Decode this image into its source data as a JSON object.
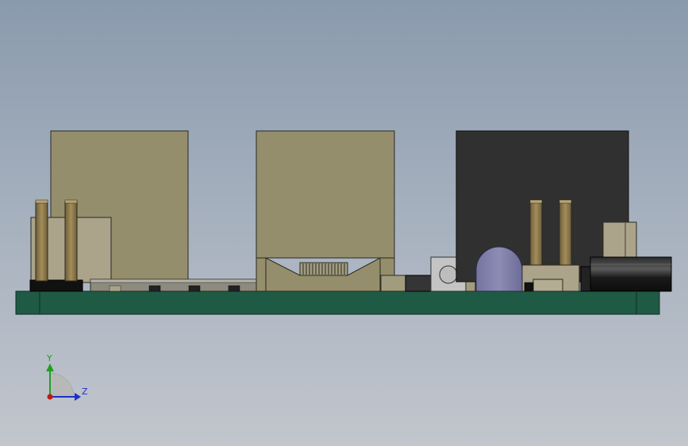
{
  "viewport": {
    "background_top": "#8a9aad",
    "background_bottom": "#c2c6cd"
  },
  "model": {
    "board_color": "#1f5a45",
    "connector_tan": "#948e6d",
    "connector_dark": "#303030",
    "pin_color": "#8e7a4c",
    "led_color": "#8080a8",
    "cylinder_color": "#1a1a1a"
  },
  "triad": {
    "y_label": "Y",
    "z_label": "Z",
    "y_color": "#1fa01f",
    "z_color": "#1f2fc8",
    "x_color": "#c01818"
  }
}
